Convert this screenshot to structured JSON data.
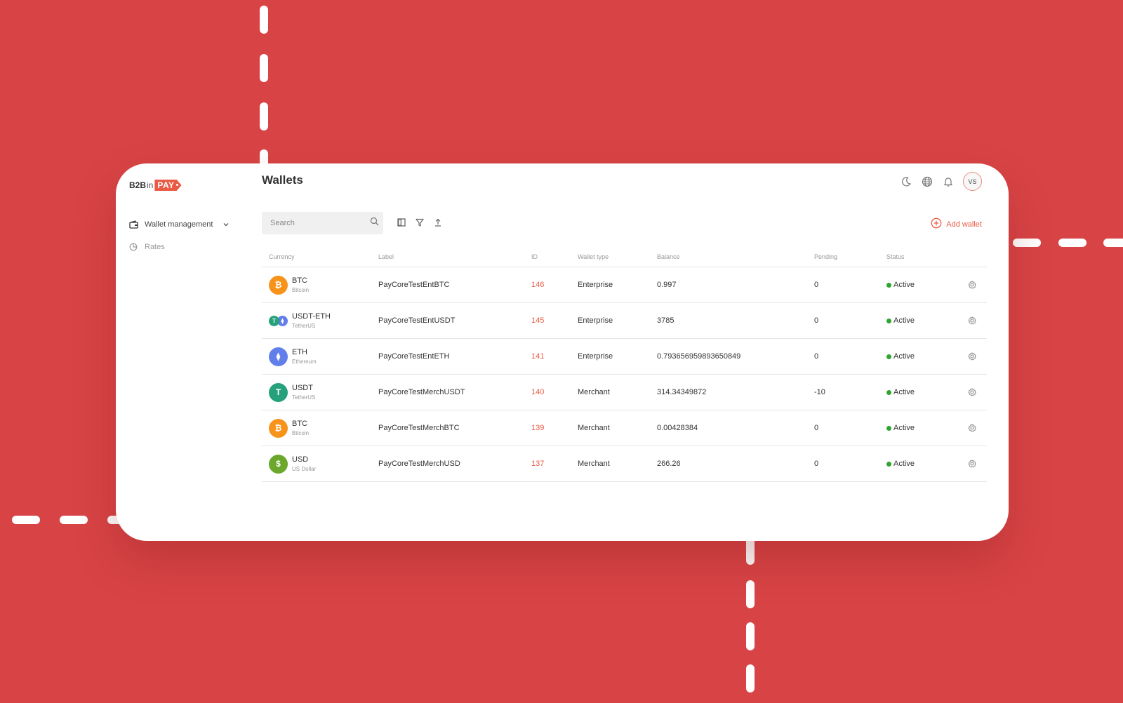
{
  "app": {
    "logo": {
      "part1": "B2B",
      "part2": "in",
      "part3": "PAY"
    },
    "page_title": "Wallets"
  },
  "sidebar": {
    "items": [
      {
        "label": "Wallet management",
        "icon": "wallet-icon",
        "expandable": true
      },
      {
        "label": "Rates",
        "icon": "rates-icon",
        "expandable": false
      }
    ]
  },
  "header": {
    "icons": [
      "moon-icon",
      "globe-icon",
      "bell-icon"
    ],
    "avatar_initials": "VS"
  },
  "toolbar": {
    "search_placeholder": "Search",
    "search_value": "",
    "tools": [
      "columns-icon",
      "filter-icon",
      "export-icon"
    ],
    "add_wallet_label": "Add wallet"
  },
  "colors": {
    "accent": "#ea5b45",
    "background": "#d84446",
    "status_active": "#2ea52e"
  },
  "table": {
    "columns": [
      "Currency",
      "Label",
      "ID",
      "Wallet type",
      "Balance",
      "Pending",
      "Status"
    ],
    "rows": [
      {
        "code": "BTC",
        "name": "Bitcoin",
        "coin": "btc",
        "label": "PayCoreTestEntBTC",
        "id": "146",
        "type": "Enterprise",
        "balance": "0.997",
        "pending": "0",
        "status": "Active"
      },
      {
        "code": "USDT-ETH",
        "name": "TetherUS",
        "coin": "usdt-eth",
        "label": "PayCoreTestEntUSDT",
        "id": "145",
        "type": "Enterprise",
        "balance": "3785",
        "pending": "0",
        "status": "Active"
      },
      {
        "code": "ETH",
        "name": "Ethereum",
        "coin": "eth",
        "label": "PayCoreTestEntETH",
        "id": "141",
        "type": "Enterprise",
        "balance": "0.793656959893650849",
        "pending": "0",
        "status": "Active"
      },
      {
        "code": "USDT",
        "name": "TetherUS",
        "coin": "usdt",
        "label": "PayCoreTestMerchUSDT",
        "id": "140",
        "type": "Merchant",
        "balance": "314.34349872",
        "pending": "-10",
        "status": "Active"
      },
      {
        "code": "BTC",
        "name": "Bitcoin",
        "coin": "btc",
        "label": "PayCoreTestMerchBTC",
        "id": "139",
        "type": "Merchant",
        "balance": "0.00428384",
        "pending": "0",
        "status": "Active"
      },
      {
        "code": "USD",
        "name": "US Dollar",
        "coin": "usd",
        "label": "PayCoreTestMerchUSD",
        "id": "137",
        "type": "Merchant",
        "balance": "266.26",
        "pending": "0",
        "status": "Active"
      }
    ]
  }
}
